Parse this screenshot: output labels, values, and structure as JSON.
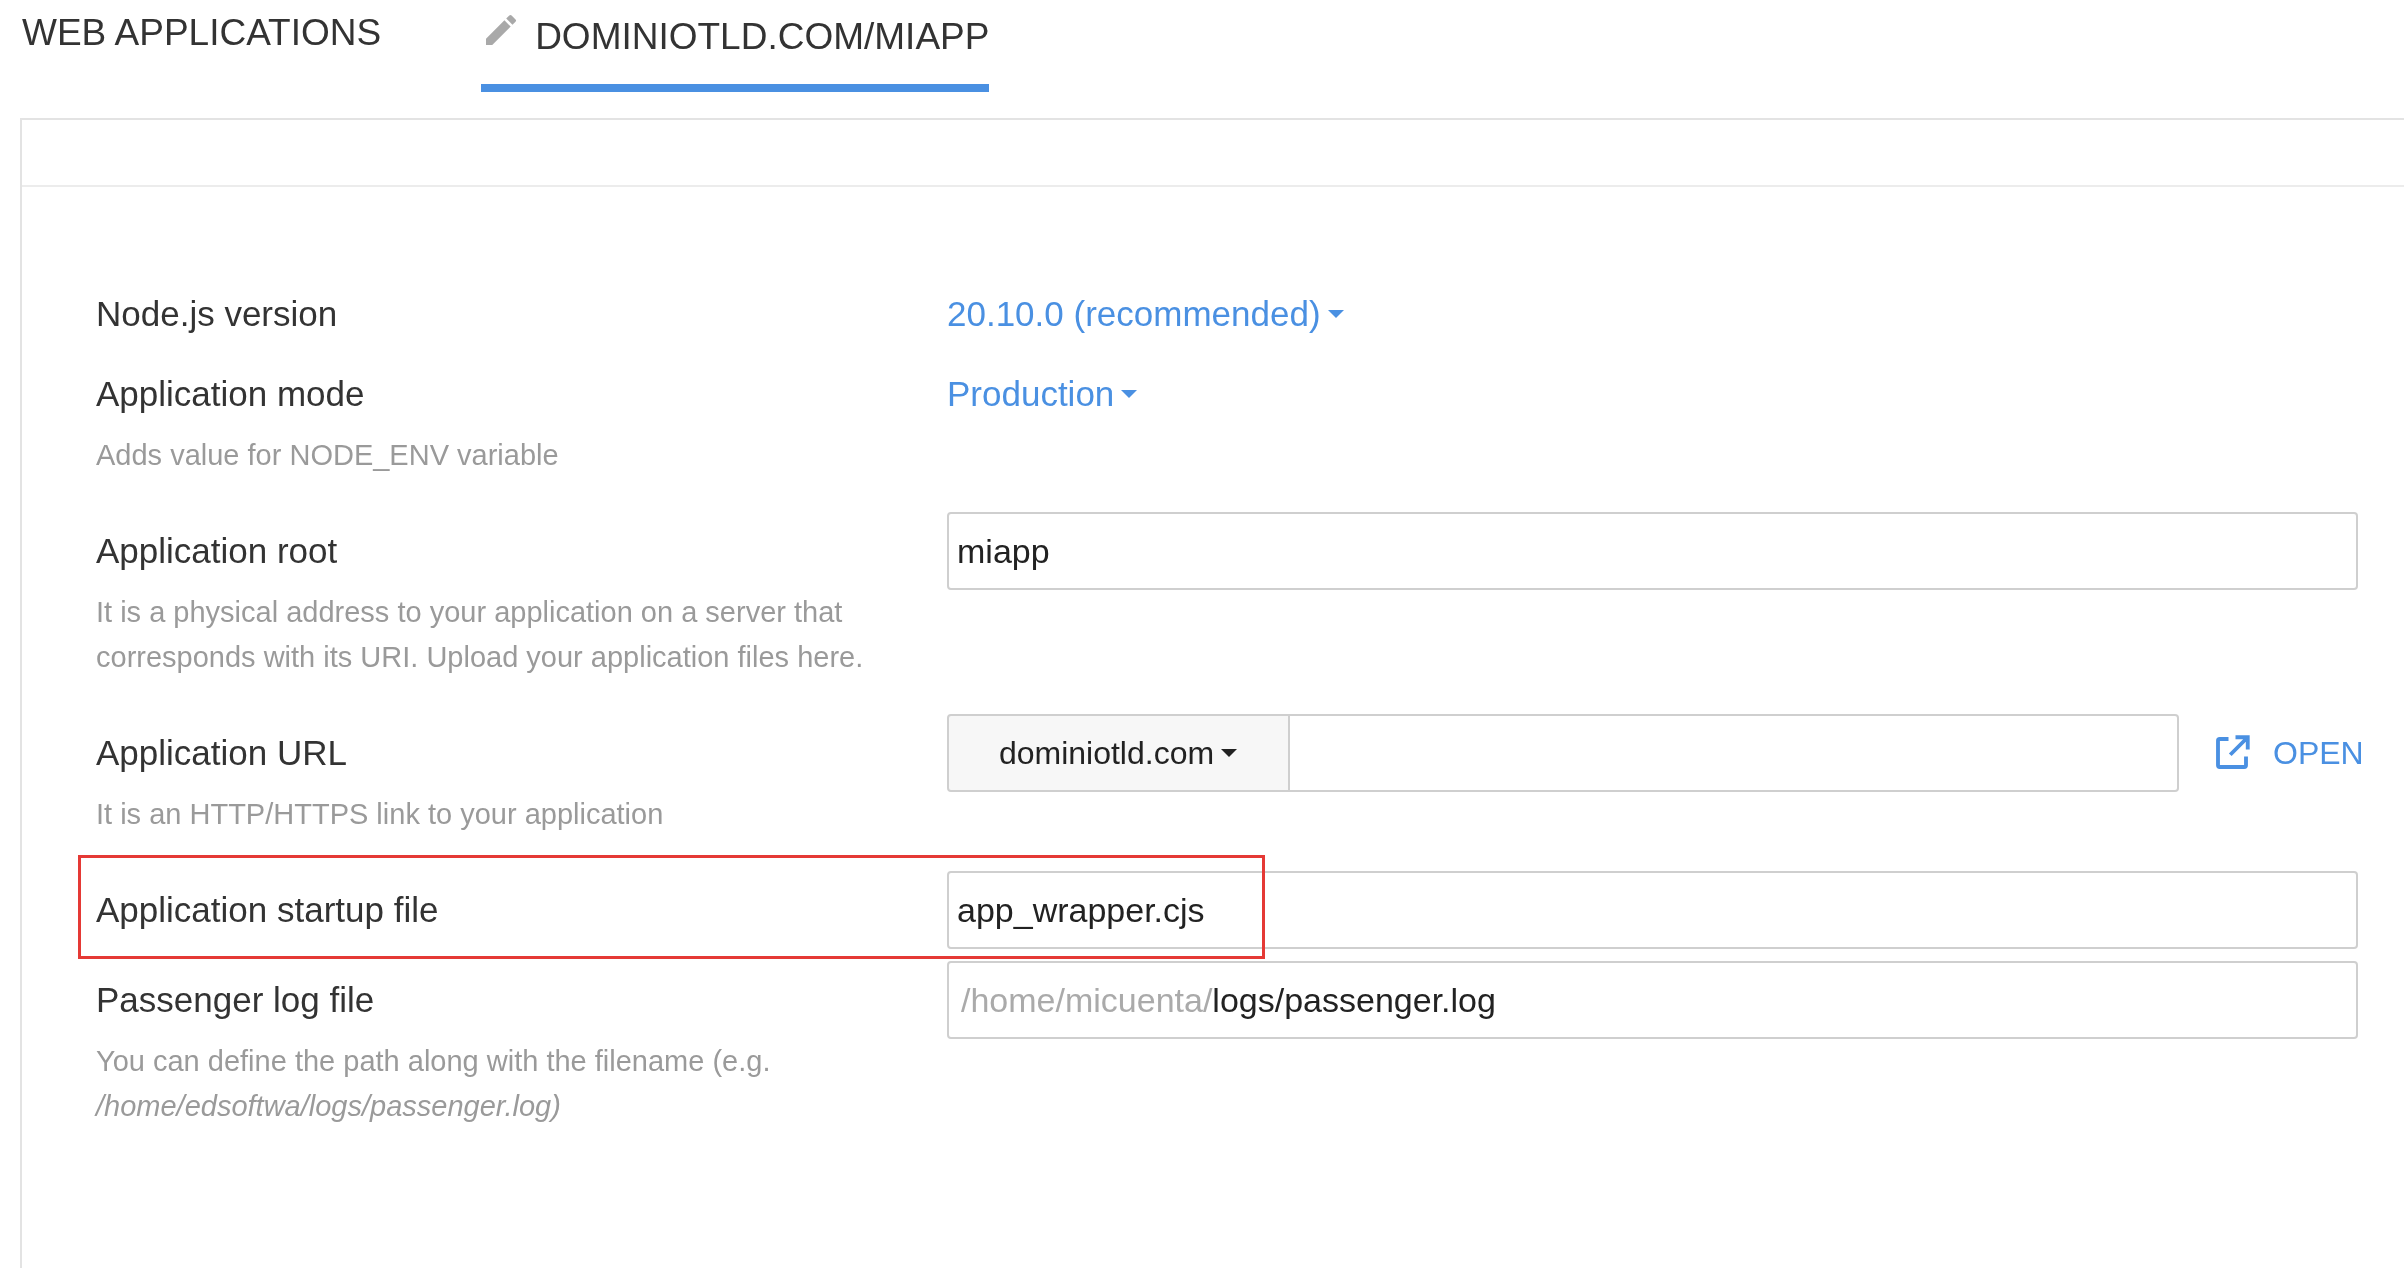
{
  "tabs": [
    {
      "label": "WEB APPLICATIONS",
      "kind": "plain",
      "selected": false
    },
    {
      "label": "DOMINIOTLD.COM/MIAPP",
      "kind": "edit",
      "selected": true
    }
  ],
  "fields": [
    {
      "kind": "dropdown",
      "label": "Node.js version",
      "value": "20.10.0 (recommended)",
      "highlighted": false
    },
    {
      "kind": "dropdown",
      "label": "Application mode",
      "value": "Production",
      "hint": "Adds value for NODE_ENV variable",
      "highlighted": false
    },
    {
      "kind": "text",
      "label": "Application root",
      "value": "miapp",
      "hint": "It is a physical address to your application on a server that corresponds with its URI. Upload your application files here.",
      "highlighted": false
    },
    {
      "kind": "url",
      "label": "Application URL",
      "domain": "dominiotld.com",
      "open_label": "OPEN",
      "hint": "It is an HTTP/HTTPS link to your application",
      "highlighted": false
    },
    {
      "kind": "text",
      "label": "Application startup file",
      "value": "app_wrapper.cjs",
      "highlighted": true
    },
    {
      "kind": "path",
      "label": "Passenger log file",
      "prefix": "/home/micuenta/",
      "value": "logs/passenger.log",
      "hint": "You can define the path along with the filename (e.g. */home/edsoftwa/logs/passenger.log)*",
      "highlighted": false
    }
  ]
}
